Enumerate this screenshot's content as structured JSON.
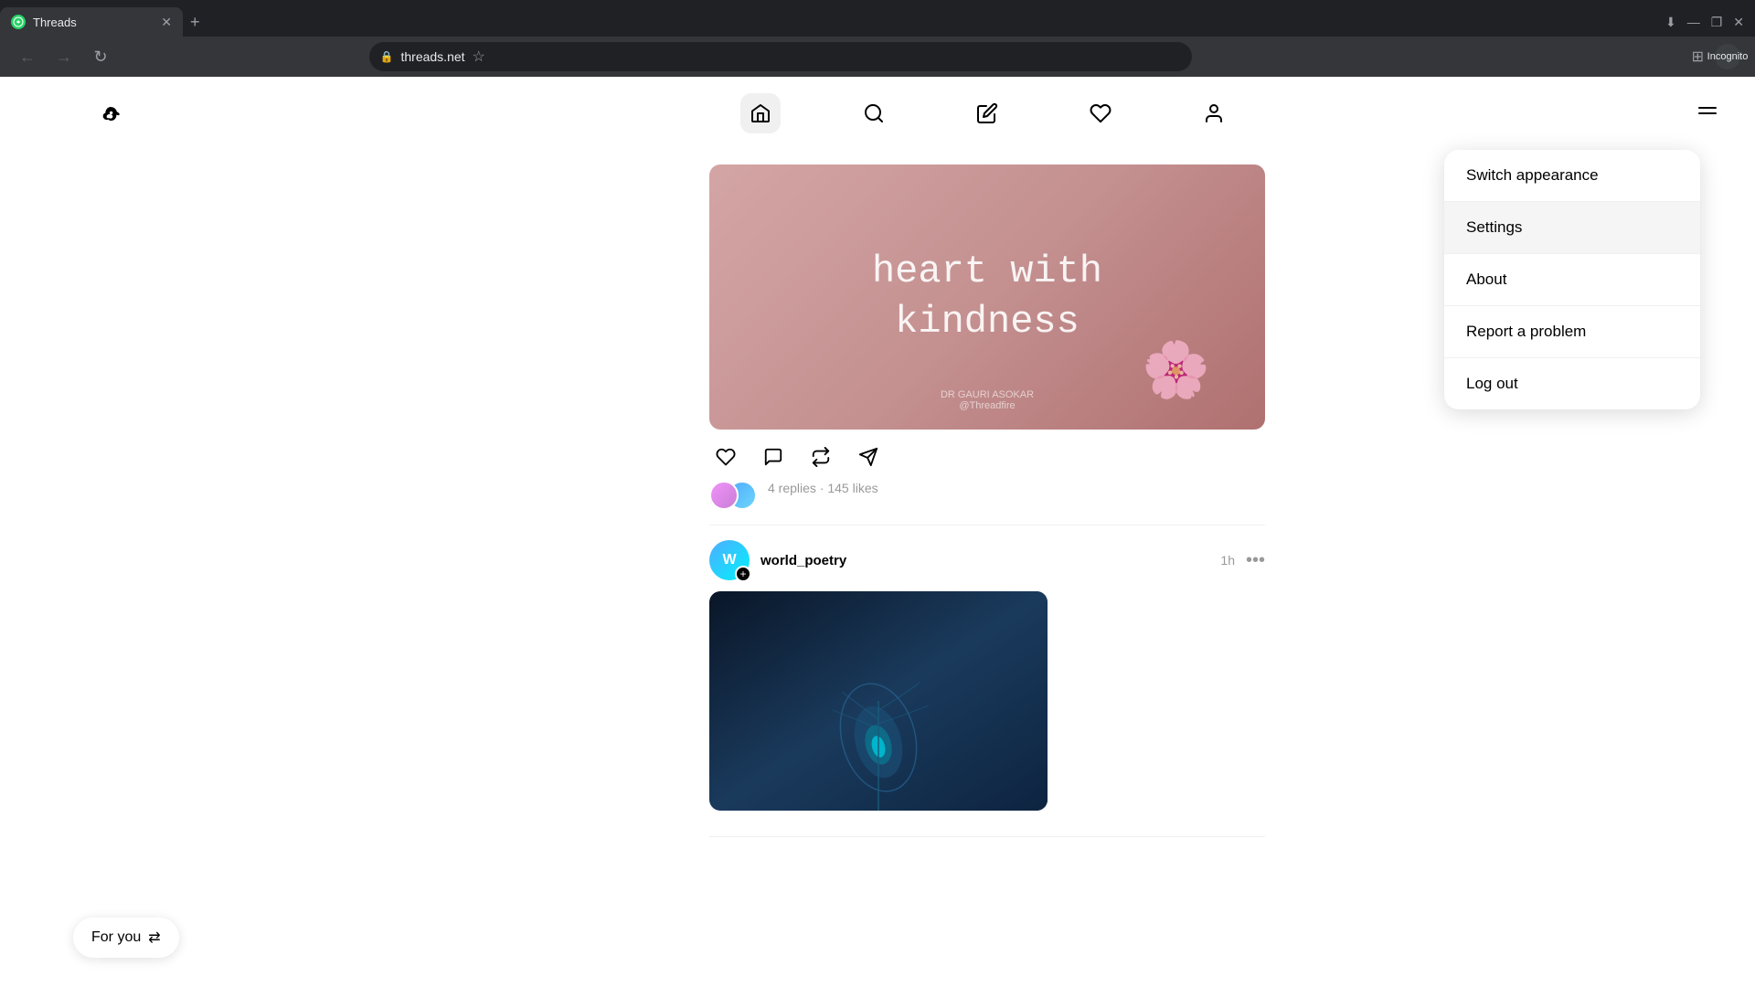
{
  "browser": {
    "tab_favicon": "T",
    "tab_title": "Threads",
    "url": "threads.net",
    "incognito_label": "Incognito"
  },
  "app": {
    "logo_alt": "Threads logo",
    "nav": {
      "home_icon": "🏠",
      "search_icon": "🔍",
      "compose_icon": "✏️",
      "activity_icon": "♡",
      "profile_icon": "👤",
      "menu_icon": "≡"
    },
    "posts": [
      {
        "id": "post1",
        "image_text": "heart with\nkindness",
        "watermark_line1": "DR GAURI ASOKAR",
        "watermark_line2": "@Threadfire",
        "actions": [
          "♡",
          "💬",
          "↩",
          "➤"
        ],
        "stats": "4 replies · 145 likes"
      },
      {
        "id": "post2",
        "username": "world_poetry",
        "time": "1h"
      }
    ],
    "dropdown": {
      "items": [
        {
          "label": "Switch appearance",
          "id": "switch-appearance"
        },
        {
          "label": "Settings",
          "id": "settings"
        },
        {
          "label": "About",
          "id": "about"
        },
        {
          "label": "Report a problem",
          "id": "report-problem"
        },
        {
          "label": "Log out",
          "id": "log-out"
        }
      ]
    },
    "bottom_bar": {
      "for_you_label": "For you",
      "for_you_icon": "⇄"
    }
  }
}
